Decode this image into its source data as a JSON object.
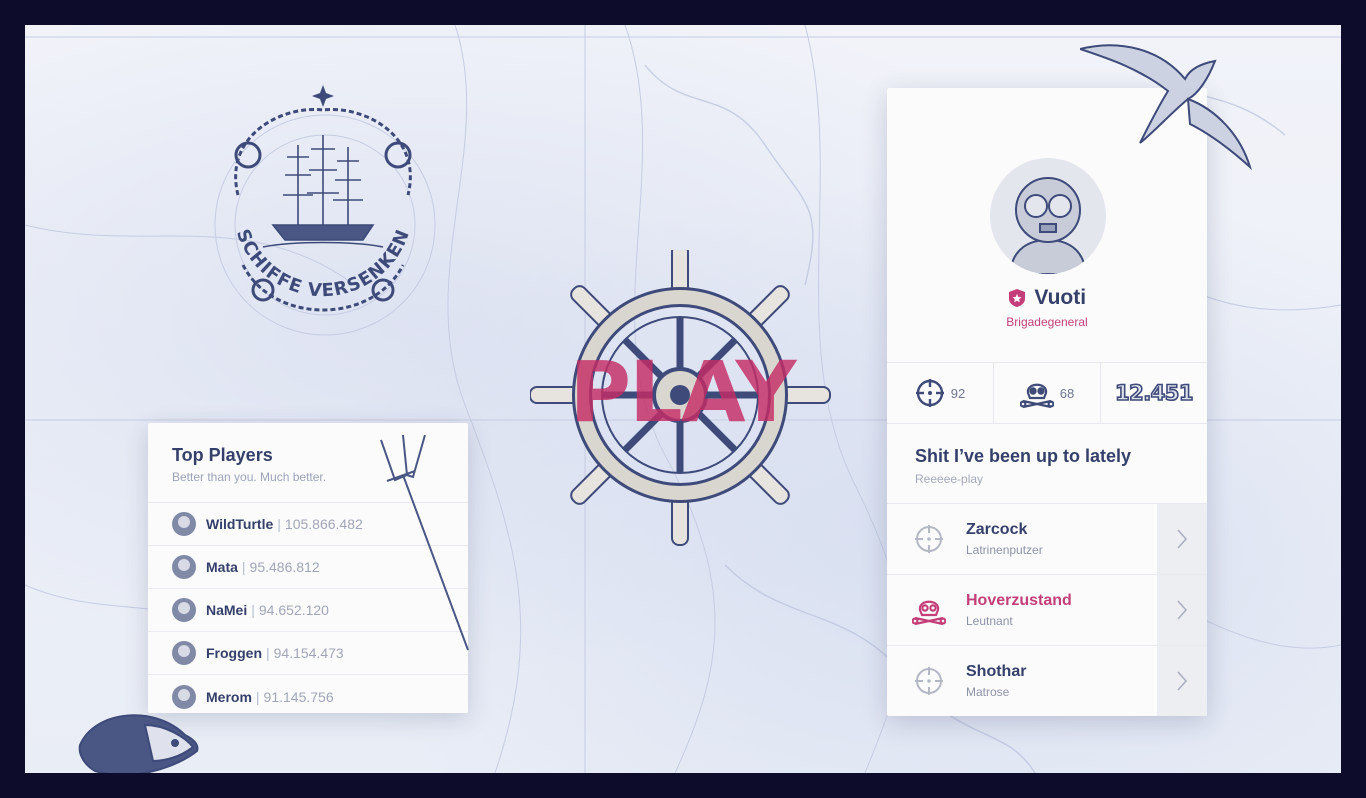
{
  "emblem": {
    "text": "SCHIFFE VERSENKEN"
  },
  "play": {
    "label": "PLAY"
  },
  "top_players": {
    "title": "Top Players",
    "subtitle": "Better than you. Much better.",
    "players": [
      {
        "name": "WildTurtle",
        "score": "105.866.482"
      },
      {
        "name": "Mata",
        "score": "95.486.812"
      },
      {
        "name": "NaMei",
        "score": "94.652.120"
      },
      {
        "name": "Froggen",
        "score": "94.154.473"
      },
      {
        "name": "Merom",
        "score": "91.145.756"
      }
    ]
  },
  "profile": {
    "name": "Vuoti",
    "rank": "Brigadegeneral",
    "stats": {
      "hits": "92",
      "kills": "68",
      "score": "12.451"
    },
    "activity_title": "Shit I’ve been up to lately",
    "activity_subtitle": "Reeeee-play",
    "activity": [
      {
        "name": "Zarcock",
        "rank": "Latrinenputzer",
        "icon": "crosshair-icon"
      },
      {
        "name": "Hoverzustand",
        "rank": "Leutnant",
        "icon": "skull-icon"
      },
      {
        "name": "Shothar",
        "rank": "Matrose",
        "icon": "crosshair-icon"
      }
    ]
  },
  "colors": {
    "accent": "#c43f7a",
    "navy": "#34406a",
    "frame": "#0d0d2b"
  }
}
